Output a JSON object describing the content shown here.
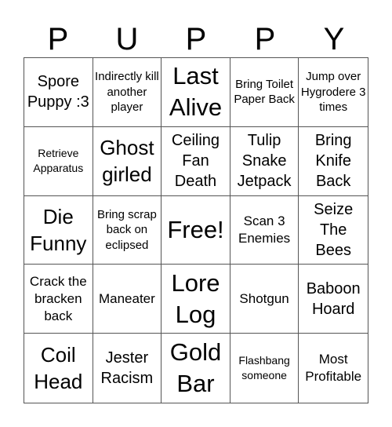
{
  "title_letters": [
    "P",
    "U",
    "P",
    "P",
    "Y"
  ],
  "cells": [
    {
      "text": "Spore Puppy :3",
      "size": "m"
    },
    {
      "text": "Indirectly kill another player",
      "size": "xs"
    },
    {
      "text": "Last Alive",
      "size": "xl"
    },
    {
      "text": "Bring Toilet Paper Back",
      "size": "xs"
    },
    {
      "text": "Jump over Hygrodere 3 times",
      "size": "xs"
    },
    {
      "text": "Retrieve Apparatus",
      "size": "xxs"
    },
    {
      "text": "Ghost girled",
      "size": "l"
    },
    {
      "text": "Ceiling Fan Death",
      "size": "m"
    },
    {
      "text": "Tulip Snake Jetpack",
      "size": "m"
    },
    {
      "text": "Bring Knife Back",
      "size": "m"
    },
    {
      "text": "Die Funny",
      "size": "l"
    },
    {
      "text": "Bring scrap back on eclipsed",
      "size": "xs"
    },
    {
      "text": "Free!",
      "size": "xl"
    },
    {
      "text": "Scan 3 Enemies",
      "size": "s"
    },
    {
      "text": "Seize The Bees",
      "size": "m"
    },
    {
      "text": "Crack the bracken back",
      "size": "s"
    },
    {
      "text": "Maneater",
      "size": "s"
    },
    {
      "text": "Lore Log",
      "size": "xl"
    },
    {
      "text": "Shotgun",
      "size": "s"
    },
    {
      "text": "Baboon Hoard",
      "size": "m"
    },
    {
      "text": "Coil Head",
      "size": "l"
    },
    {
      "text": "Jester Racism",
      "size": "m"
    },
    {
      "text": "Gold Bar",
      "size": "xl"
    },
    {
      "text": "Flashbang someone",
      "size": "xxs"
    },
    {
      "text": "Most Profitable",
      "size": "s"
    }
  ]
}
